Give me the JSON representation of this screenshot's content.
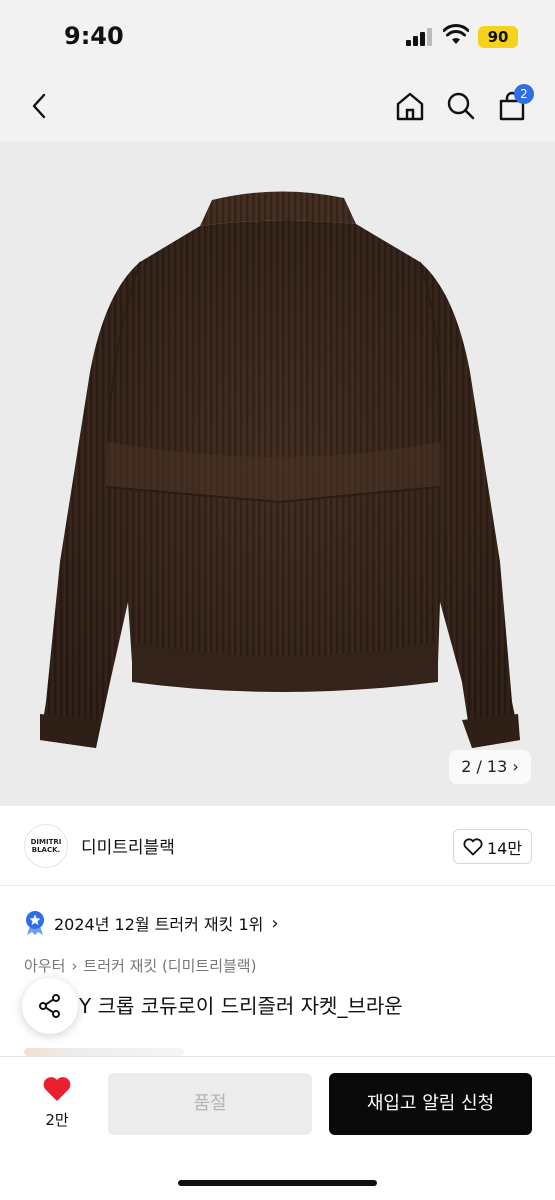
{
  "status": {
    "time": "9:40",
    "battery": "90"
  },
  "nav": {
    "cart_count": "2"
  },
  "gallery": {
    "counter": "2 / 13",
    "counter_arrow": "›"
  },
  "brand": {
    "logo_text_1": "DIMITRI",
    "logo_text_2": "BLACK.",
    "name": "디미트리블랙",
    "likes": "14만"
  },
  "ranking": {
    "text": "2024년 12월 트러커 재킷 1위",
    "arrow": "›"
  },
  "breadcrumb": {
    "category": "아우터",
    "separator": "›",
    "subcategory": "트러커 재킷 (디미트리블랙)"
  },
  "product": {
    "title": "Y 크롭 코듀로이 드리즐러 자켓_브라운"
  },
  "bottom": {
    "wish_count": "2만",
    "soldout_label": "품절",
    "restock_label": "재입고 알림 신청"
  },
  "colors": {
    "accent_blue": "#2f6ee5",
    "heart_red": "#e8202f",
    "jacket_brown": "#3f2b20",
    "battery_yellow": "#f5d31a"
  }
}
